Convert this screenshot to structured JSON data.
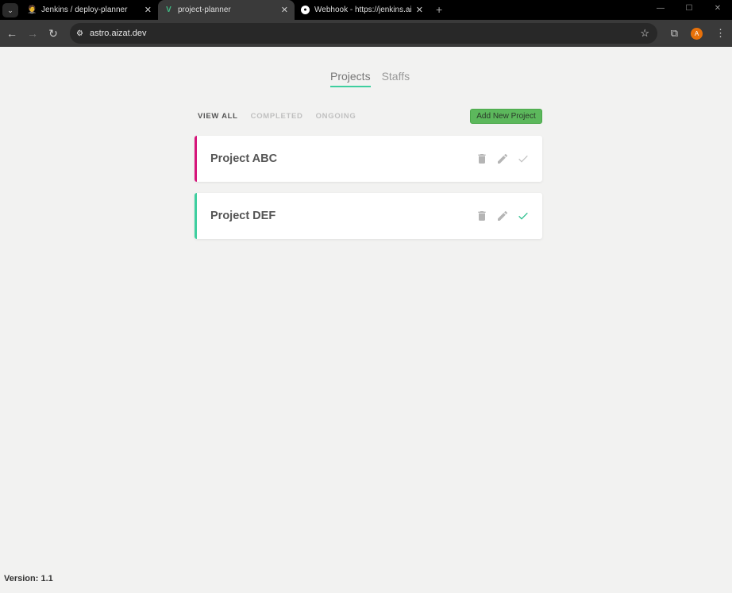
{
  "browser": {
    "tabs": [
      {
        "title": "Jenkins / deploy-planner",
        "icon": "jenkins-icon",
        "active": false
      },
      {
        "title": "project-planner",
        "icon": "vue-icon",
        "active": true
      },
      {
        "title": "Webhook - https://jenkins.aizat.",
        "icon": "github-icon",
        "active": false
      }
    ],
    "url": "astro.aizat.dev",
    "avatar_letter": "A"
  },
  "nav": {
    "tabs": [
      {
        "label": "Projects",
        "active": true
      },
      {
        "label": "Staffs",
        "active": false
      }
    ]
  },
  "filters": [
    {
      "label": "VIEW ALL",
      "active": true
    },
    {
      "label": "COMPLETED",
      "active": false
    },
    {
      "label": "ONGOING",
      "active": false
    }
  ],
  "add_button": "Add New Project",
  "projects": [
    {
      "name": "Project ABC",
      "completed": false,
      "border_color": "#d6157a"
    },
    {
      "name": "Project DEF",
      "completed": true,
      "border_color": "#3ecf9f"
    }
  ],
  "colors": {
    "accent": "#3ecf9f",
    "button": "#5cb85c",
    "icon_gray": "#b5b5b5"
  },
  "footer": {
    "version": "Version: 1.1"
  }
}
